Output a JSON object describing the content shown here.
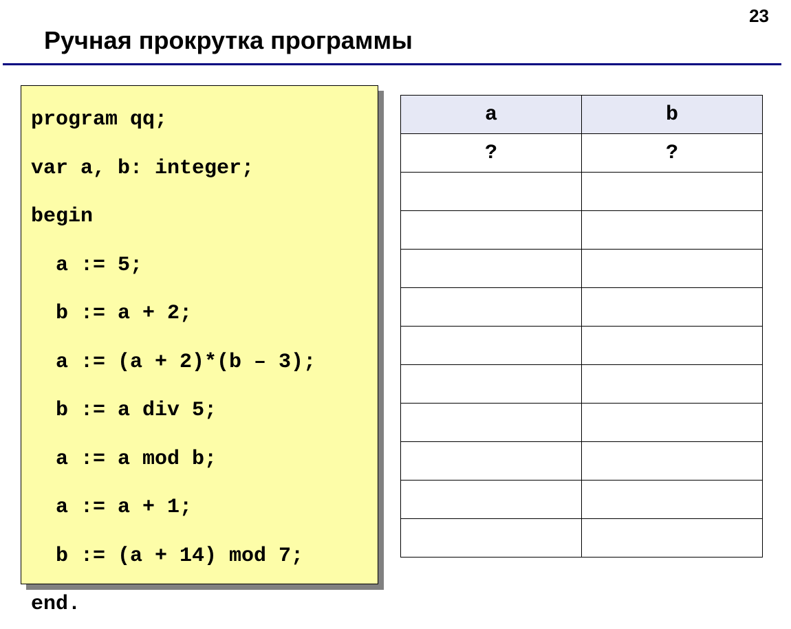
{
  "page_number": "23",
  "heading": "Ручная прокрутка программы",
  "code": "program qq;\nvar a, b: integer;\nbegin\n  a := 5;\n  b := a + 2;\n  a := (a + 2)*(b – 3);\n  b := a div 5;\n  a := a mod b;\n  a := a + 1;\n  b := (a + 14) mod 7;\nend.",
  "table": {
    "headers": [
      "a",
      "b"
    ],
    "rows": [
      [
        "?",
        "?"
      ],
      [
        "",
        ""
      ],
      [
        "",
        ""
      ],
      [
        "",
        ""
      ],
      [
        "",
        ""
      ],
      [
        "",
        ""
      ],
      [
        "",
        ""
      ],
      [
        "",
        ""
      ],
      [
        "",
        ""
      ],
      [
        "",
        ""
      ],
      [
        "",
        ""
      ]
    ]
  }
}
